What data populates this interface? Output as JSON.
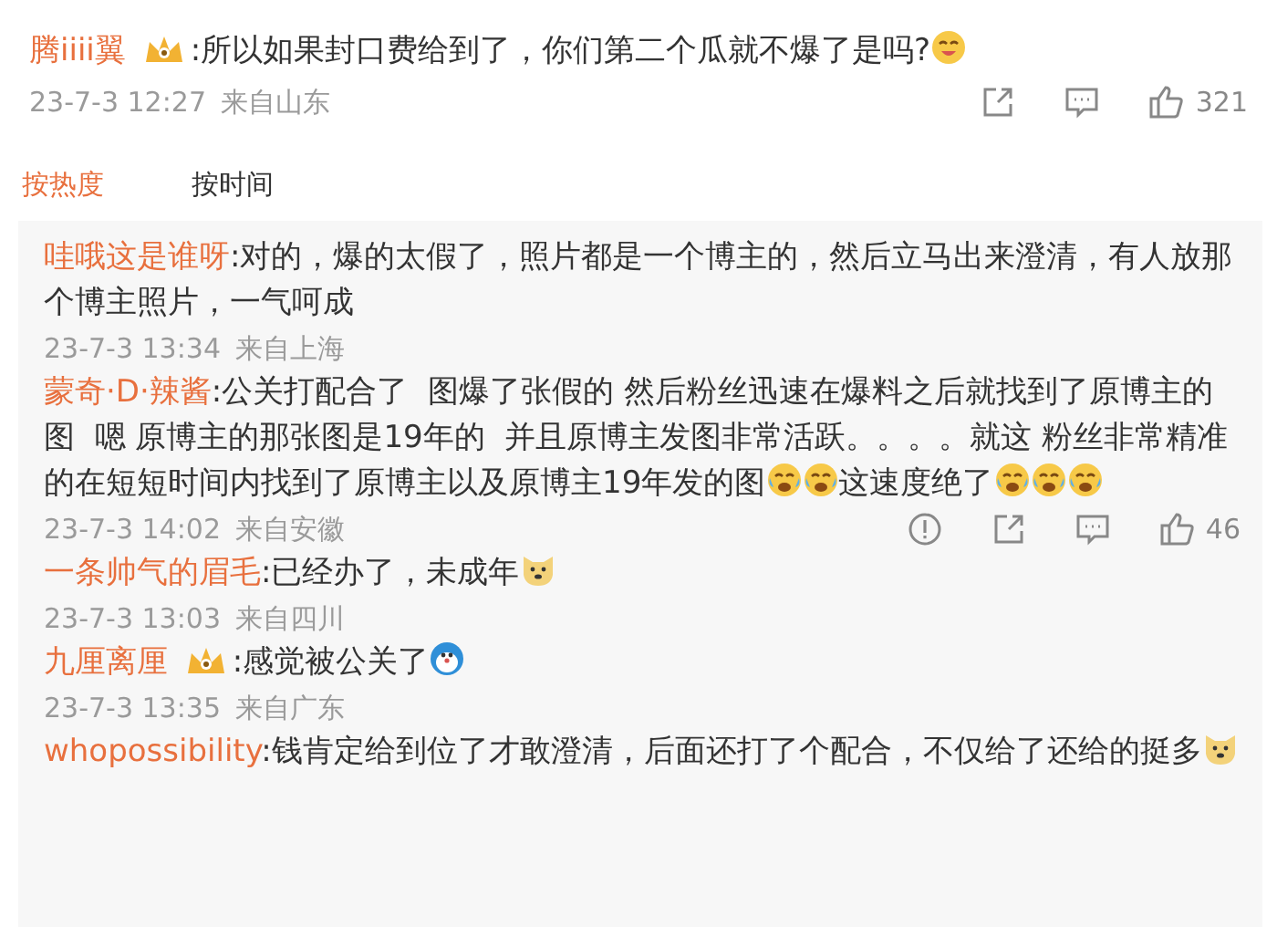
{
  "comment": {
    "user": "腾iiii翼",
    "badge": true,
    "content": [
      {
        "kind": "text",
        "text": ":所以如果封口费给到了，你们第二个瓜就不爆了是吗?"
      },
      {
        "kind": "grin"
      }
    ],
    "time": "23-7-3 12:27",
    "location": "来自山东",
    "actions": [
      {
        "kind": "share"
      },
      {
        "kind": "comment"
      },
      {
        "kind": "like",
        "count": "321"
      }
    ]
  },
  "sort_tabs": [
    {
      "label": "按热度",
      "selected": true
    },
    {
      "label": "按时间",
      "selected": false
    }
  ],
  "replies": [
    {
      "user": "哇哦这是谁呀",
      "badge": false,
      "content": [
        {
          "kind": "text",
          "text": ":对的，爆的太假了，照片都是一个博主的，然后立马出来澄清，有人放那个博主照片，一气呵成"
        }
      ],
      "time": "23-7-3 13:34",
      "location": "来自上海"
    },
    {
      "user": "蒙奇·D·辣酱",
      "badge": false,
      "content": [
        {
          "kind": "text",
          "text": ":公关打配合了  图爆了张假的 然后粉丝迅速在爆料之后就找到了原博主的图  嗯 原博主的那张图是19年的  并且原博主发图非常活跃。。。。就这 粉丝非常精准的在短短时间内找到了原博主以及原博主19年发的图"
        },
        {
          "kind": "cry"
        },
        {
          "kind": "cry"
        },
        {
          "kind": "text",
          "text": "这速度绝了"
        },
        {
          "kind": "cry"
        },
        {
          "kind": "cry"
        },
        {
          "kind": "cry"
        }
      ],
      "time": "23-7-3 14:02",
      "location": "来自安徽",
      "actions": [
        {
          "kind": "report"
        },
        {
          "kind": "share"
        },
        {
          "kind": "comment"
        },
        {
          "kind": "like",
          "count": "46"
        }
      ]
    },
    {
      "user": "一条帅气的眉毛",
      "badge": false,
      "content": [
        {
          "kind": "text",
          "text": ":已经办了，未成年"
        },
        {
          "kind": "dog"
        }
      ],
      "time": "23-7-3 13:03",
      "location": "来自四川"
    },
    {
      "user": "九厘离厘",
      "badge": true,
      "content": [
        {
          "kind": "text",
          "text": ":感觉被公关了"
        },
        {
          "kind": "robot"
        }
      ],
      "time": "23-7-3 13:35",
      "location": "来自广东"
    },
    {
      "user": "whopossibility",
      "badge": false,
      "content": [
        {
          "kind": "text",
          "text": ":钱肯定给到位了才敢澄清，后面还打了个配合，不仅给了还给的挺多"
        },
        {
          "kind": "dog"
        }
      ]
    }
  ]
}
